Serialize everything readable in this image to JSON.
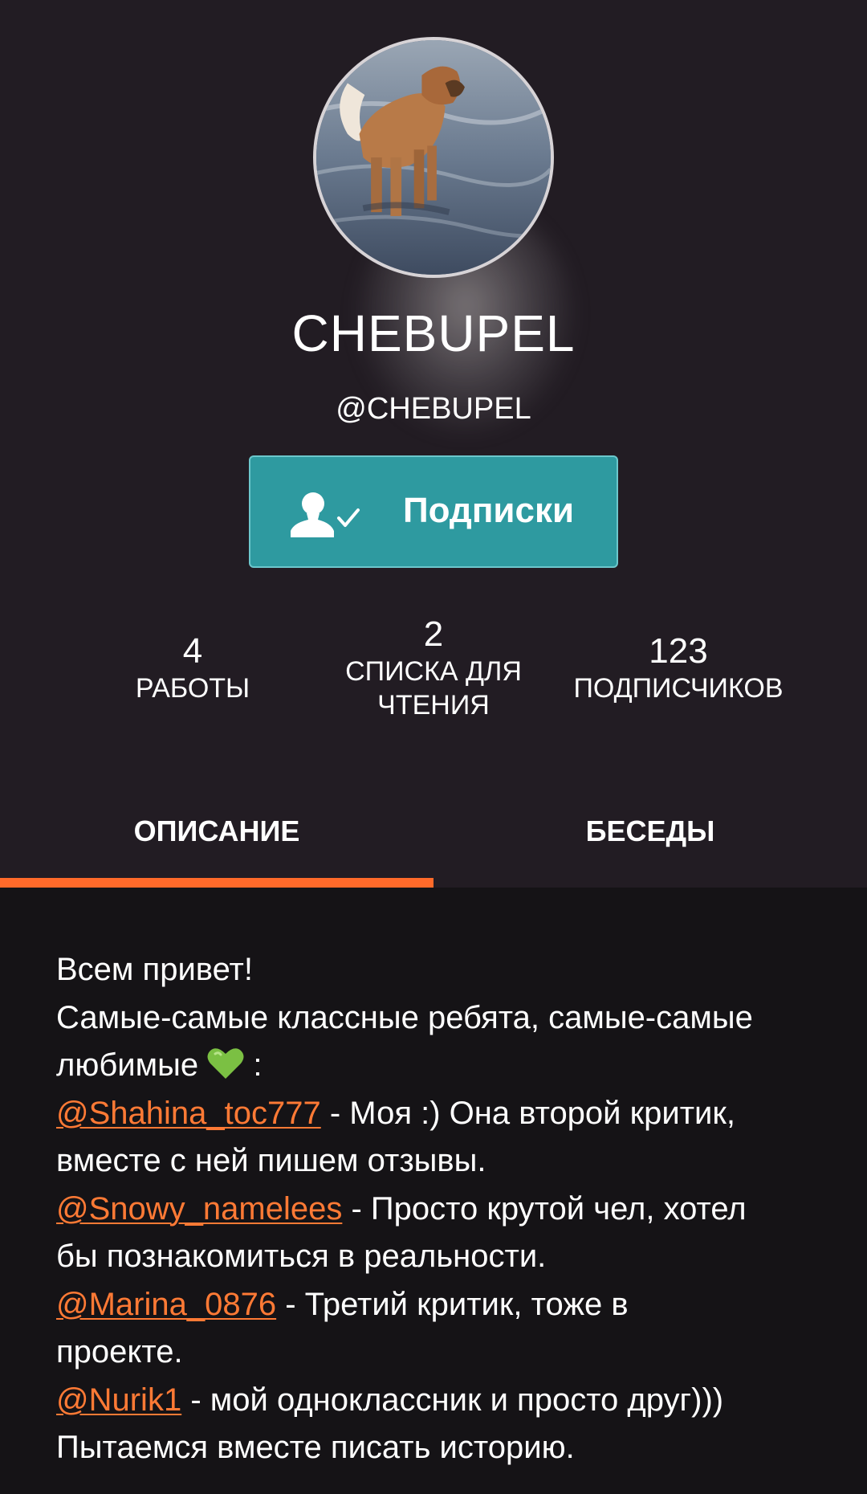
{
  "profile": {
    "name": "CHEBUPEL",
    "handle": "@CHEBUPEL"
  },
  "follow_button": {
    "label": "Подписки",
    "icon": "user-check-icon"
  },
  "stats": [
    {
      "value": "4",
      "label_line1": "РАБОТЫ",
      "label_line2": ""
    },
    {
      "value": "2",
      "label_line1": "СПИСКА ДЛЯ",
      "label_line2": "ЧТЕНИЯ"
    },
    {
      "value": "123",
      "label_line1": "ПОДПИСЧИКОВ",
      "label_line2": ""
    }
  ],
  "tabs": [
    {
      "label": "ОПИСАНИЕ",
      "active": true
    },
    {
      "label": "БЕСЕДЫ",
      "active": false
    }
  ],
  "description": {
    "greeting": "Всем привет!",
    "intro_line1": "Самые-самые классные ребята, самые-самые",
    "intro_line2": "любимые",
    "intro_tail": " :",
    "heart_icon": "green-heart-icon",
    "mentions": [
      {
        "handle": "@Shahina_toc777",
        "text_line1": " - Моя :) Она второй критик,",
        "text_line2": "вместе с ней пишем отзывы."
      },
      {
        "handle": "@Snowy_namelees",
        "text_line1": " - Просто крутой чел, хотел",
        "text_line2": "бы познакомиться в реальности."
      },
      {
        "handle": "@Marina_0876",
        "text_line1": " - Третий критик, тоже в",
        "text_line2": "проекте."
      },
      {
        "handle": "@Nurik1",
        "text_line1": " - мой одноклассник и просто друг)))",
        "text_line2": "Пытаемся вместе писать историю."
      }
    ]
  },
  "colors": {
    "header_bg": "#221c23",
    "page_bg": "#151316",
    "button_bg": "#2e9aa0",
    "accent": "#ff6a2a",
    "mention": "#ff7a35",
    "heart": "#7bc043"
  }
}
